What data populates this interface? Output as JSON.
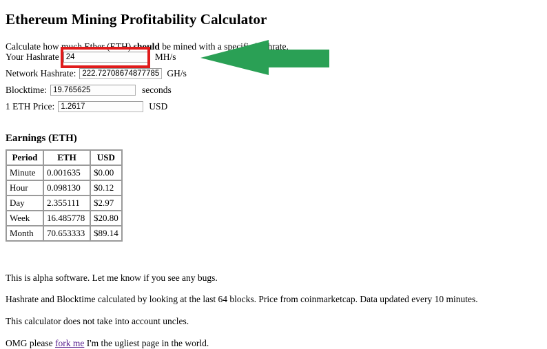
{
  "page": {
    "title": "Ethereum Mining Profitability Calculator",
    "intro_before": "Calculate how much Ether (ETH) ",
    "intro_emphasis": "should",
    "intro_after": " be mined with a specific hashrate."
  },
  "form": {
    "hashrate": {
      "label": "Your Hashrate",
      "value": "24",
      "unit": "MH/s"
    },
    "network_hashrate": {
      "label": "Network Hashrate:",
      "value": "222.72708674877785",
      "unit": "GH/s"
    },
    "blocktime": {
      "label": "Blocktime:",
      "value": "19.765625",
      "unit": "seconds"
    },
    "eth_price": {
      "label": "1 ETH Price:",
      "value": "1.2617",
      "unit": "USD"
    }
  },
  "annotations": {
    "highlight_box_color": "#e01b1b",
    "arrow_color": "#2aa055",
    "arrow_direction": "left",
    "highlight_target": "hashrate-input"
  },
  "earnings": {
    "heading": "Earnings (ETH)",
    "columns": [
      "Period",
      "ETH",
      "USD"
    ],
    "rows": [
      {
        "period": "Minute",
        "eth": "0.001635",
        "usd": "$0.00"
      },
      {
        "period": "Hour",
        "eth": "0.098130",
        "usd": "$0.12"
      },
      {
        "period": "Day",
        "eth": "2.355111",
        "usd": "$2.97"
      },
      {
        "period": "Week",
        "eth": "16.485778",
        "usd": "$20.80"
      },
      {
        "period": "Month",
        "eth": "70.653333",
        "usd": "$89.14"
      }
    ]
  },
  "notes": {
    "alpha": "This is alpha software. Let me know if you see any bugs.",
    "calc": "Hashrate and Blocktime calculated by looking at the last 64 blocks. Price from coinmarketcap. Data updated every 10 minutes.",
    "uncles": "This calculator does not take into account uncles.",
    "fork_before": "OMG please ",
    "fork_link": "fork me",
    "fork_after": " I'm the ugliest page in the world."
  }
}
